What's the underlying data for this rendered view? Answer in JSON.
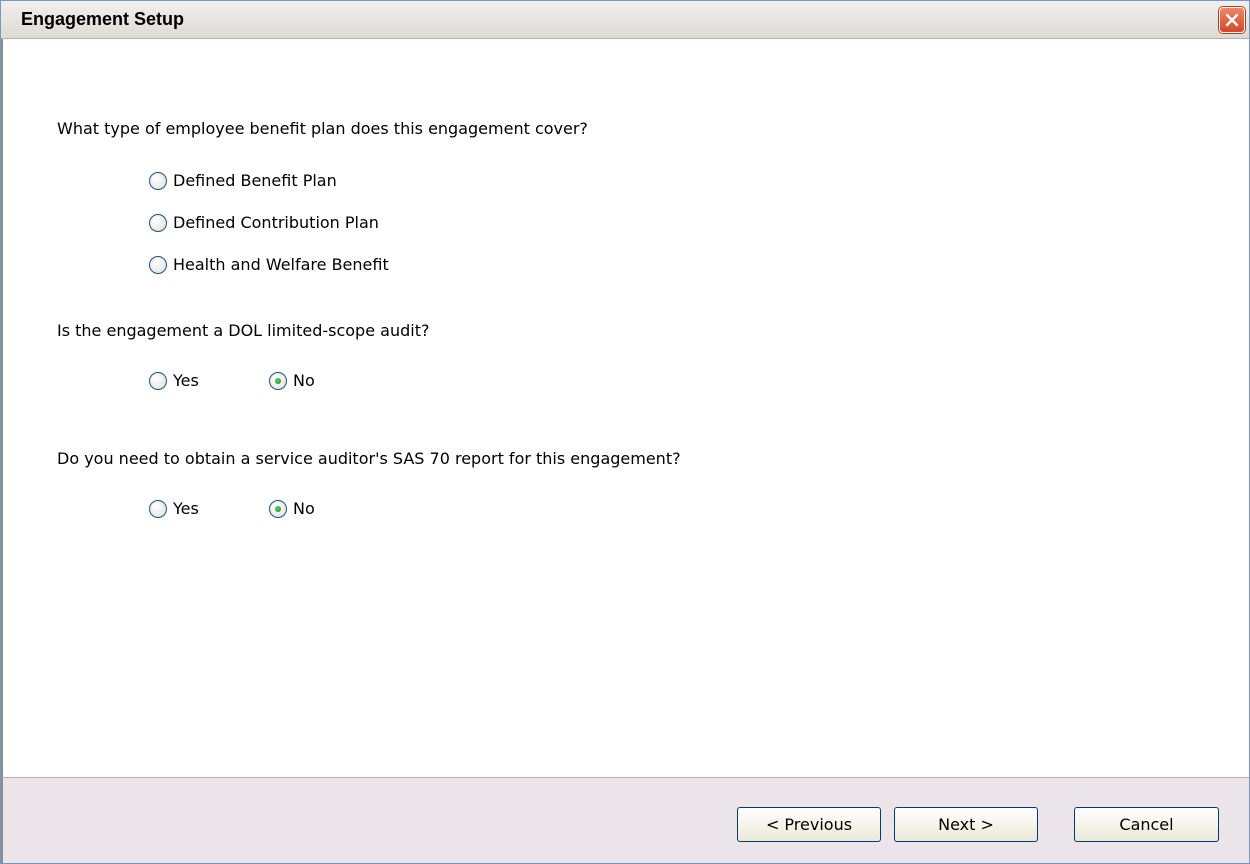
{
  "window": {
    "title": "Engagement Setup"
  },
  "questions": {
    "plan_type": {
      "text": "What type of employee benefit plan does this engagement cover?",
      "options": [
        "Defined Benefit Plan",
        "Defined Contribution Plan",
        "Health and Welfare Benefit"
      ],
      "selected": null
    },
    "dol_audit": {
      "text": "Is the engagement a DOL limited-scope audit?",
      "options": [
        "Yes",
        "No"
      ],
      "selected": "No"
    },
    "sas70": {
      "text": "Do you need to obtain a service auditor's SAS 70 report for this engagement?",
      "options": [
        "Yes",
        "No"
      ],
      "selected": "No"
    }
  },
  "buttons": {
    "previous": "< Previous",
    "next": "Next >",
    "cancel": "Cancel"
  },
  "colors": {
    "footer_bg": "#ebe4e8",
    "radio_border": "#1d5281",
    "radio_dot": "#2aa02a",
    "close_button": "#d14a2a"
  }
}
